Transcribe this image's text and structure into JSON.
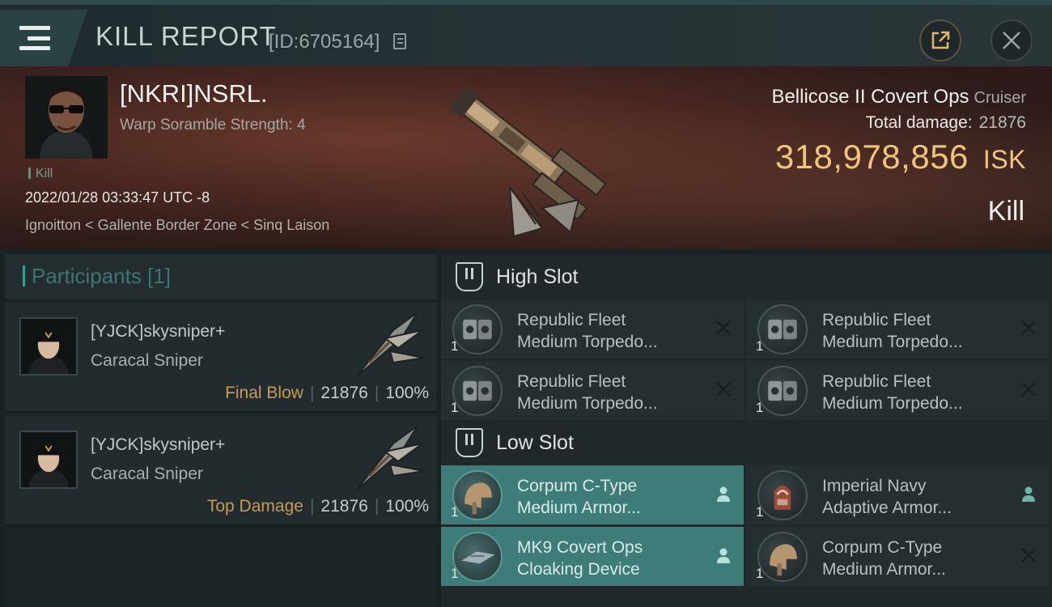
{
  "header": {
    "title": "KILL REPORT",
    "report_id": "[ID:6705164]"
  },
  "victim": {
    "pilot_name": "[NKRI]NSRL.",
    "scramble_strength": "Warp Soramble Strength: 4",
    "kill_tag": "Kill",
    "datetime": "2022/01/28 03:33:47 UTC -8",
    "location": "Ignoitton < Gallente Border Zone < Sinq Laison",
    "ship_name": "Bellicose II Covert Ops",
    "ship_class": "Cruiser",
    "total_damage_label": "Total damage:",
    "total_damage": "21876",
    "isk_value": "318,978,856",
    "isk_unit": "ISK",
    "result": "Kill"
  },
  "participants": {
    "title": "Participants [1]",
    "rows": [
      {
        "name": "[YJCK]skysniper+",
        "ship": "Caracal Sniper",
        "label": "Final Blow",
        "damage": "21876",
        "percent": "100%"
      },
      {
        "name": "[YJCK]skysniper+",
        "ship": "Caracal Sniper",
        "label": "Top Damage",
        "damage": "21876",
        "percent": "100%"
      }
    ]
  },
  "fitting": {
    "high_slot": {
      "title": "High Slot",
      "modules": [
        {
          "line1": "Republic Fleet",
          "line2": "Medium Torpedo...",
          "qty": "1",
          "state": "destroyed",
          "icon": "torpedo-launcher-icon"
        },
        {
          "line1": "Republic Fleet",
          "line2": "Medium Torpedo...",
          "qty": "1",
          "state": "destroyed",
          "icon": "torpedo-launcher-icon"
        },
        {
          "line1": "Republic Fleet",
          "line2": "Medium Torpedo...",
          "qty": "1",
          "state": "destroyed",
          "icon": "torpedo-launcher-icon"
        },
        {
          "line1": "Republic Fleet",
          "line2": "Medium Torpedo...",
          "qty": "1",
          "state": "destroyed",
          "icon": "torpedo-launcher-icon"
        }
      ]
    },
    "low_slot": {
      "title": "Low Slot",
      "modules": [
        {
          "line1": "Corpum C-Type",
          "line2": "Medium Armor...",
          "qty": "1",
          "state": "dropped",
          "icon": "armor-repairer-icon"
        },
        {
          "line1": "Imperial Navy",
          "line2": "Adaptive Armor...",
          "qty": "1",
          "state": "dropped",
          "icon": "adaptive-armor-icon"
        },
        {
          "line1": "MK9 Covert Ops",
          "line2": "Cloaking Device",
          "qty": "1",
          "state": "dropped",
          "icon": "cloaking-device-icon"
        },
        {
          "line1": "Corpum C-Type",
          "line2": "Medium Armor...",
          "qty": "1",
          "state": "destroyed",
          "icon": "armor-repairer-icon"
        }
      ]
    }
  },
  "colors": {
    "accent": "#3c7c78",
    "isk": "#f0c47a",
    "final_blow": "#c79a55"
  }
}
